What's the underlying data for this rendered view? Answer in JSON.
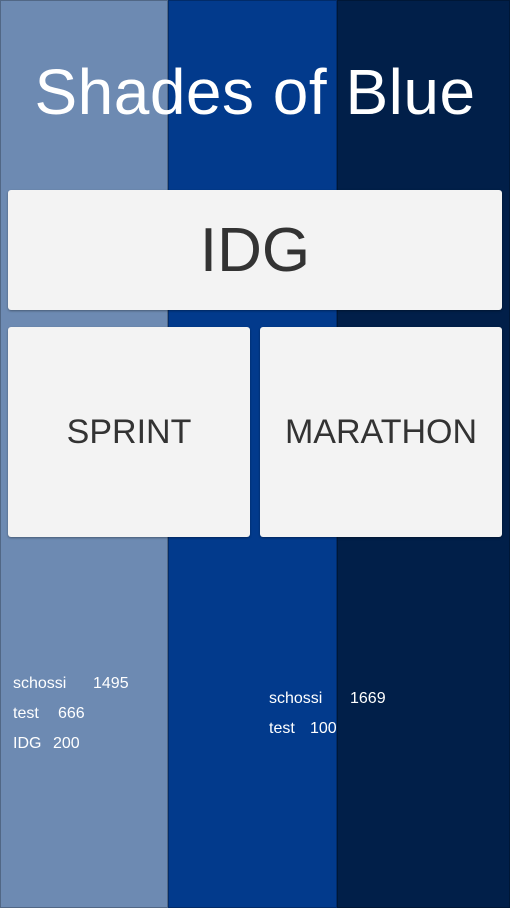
{
  "app": {
    "title": "Shades of Blue"
  },
  "theme": {
    "shade_light": "#6d8ab2",
    "shade_medium": "#023a8c",
    "shade_dark": "#011f49",
    "button_bg": "#f3f3f3",
    "button_text": "#333333"
  },
  "buttons": {
    "idg": "IDG",
    "sprint": "SPRINT",
    "marathon": "MARATHON"
  },
  "scores": {
    "sprint": [
      {
        "name": "schossi",
        "score": "1495"
      },
      {
        "name": "test",
        "score": "666"
      },
      {
        "name": "IDG",
        "score": "200"
      }
    ],
    "marathon": [
      {
        "name": "schossi",
        "score": "1669"
      },
      {
        "name": "test",
        "score": "100"
      }
    ]
  }
}
